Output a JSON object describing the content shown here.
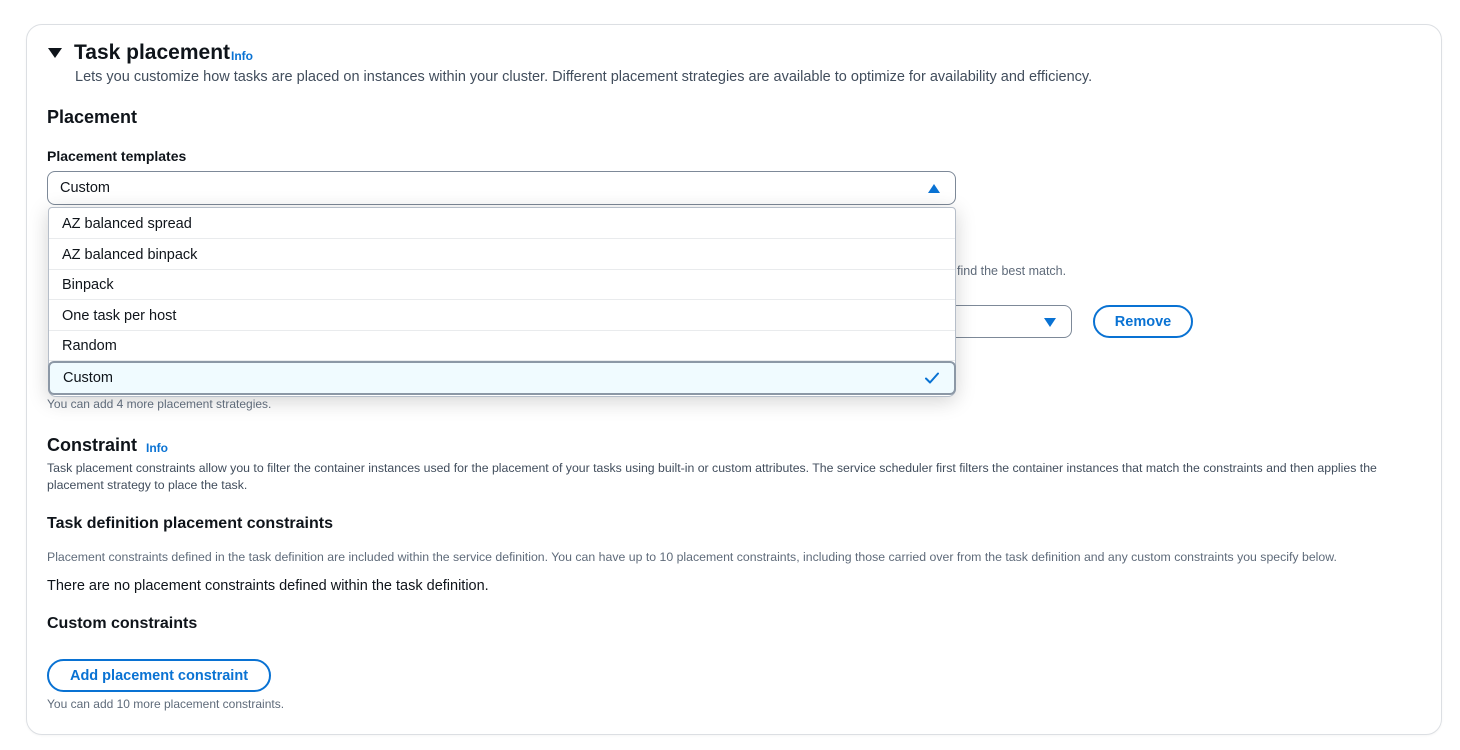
{
  "section": {
    "title": "Task placement",
    "info": "Info",
    "description": "Lets you customize how tasks are placed on instances within your cluster. Different placement strategies are available to optimize for availability and efficiency."
  },
  "placement": {
    "heading": "Placement",
    "templates_label": "Placement templates",
    "selected_value": "Custom",
    "options": [
      "AZ balanced spread",
      "AZ balanced binpack",
      "Binpack",
      "One task per host",
      "Random",
      "Custom"
    ],
    "hidden_hint_fragment": "find the best match.",
    "remove_button": "Remove",
    "strategies_note": "You can add 4 more placement strategies."
  },
  "constraint": {
    "heading": "Constraint",
    "info": "Info",
    "description": "Task placement constraints allow you to filter the container instances used for the placement of your tasks using built-in or custom attributes. The service scheduler first filters the container instances that match the constraints and then applies the placement strategy to place the task.",
    "task_def_heading": "Task definition placement constraints",
    "task_def_desc": "Placement constraints defined in the task definition are included within the service definition. You can have up to 10 placement constraints, including those carried over from the task definition and any custom constraints you specify below.",
    "task_def_empty": "There are no placement constraints defined within the task definition.",
    "custom_heading": "Custom constraints",
    "add_button": "Add placement constraint",
    "custom_note": "You can add 10 more placement constraints."
  },
  "colors": {
    "link": "#0972d3",
    "selected_bg": "#f0fbff"
  },
  "icons": {
    "expand": "caret-down-icon",
    "select_open": "triangle-up-icon",
    "select_closed": "triangle-down-icon",
    "selected": "check-icon"
  }
}
